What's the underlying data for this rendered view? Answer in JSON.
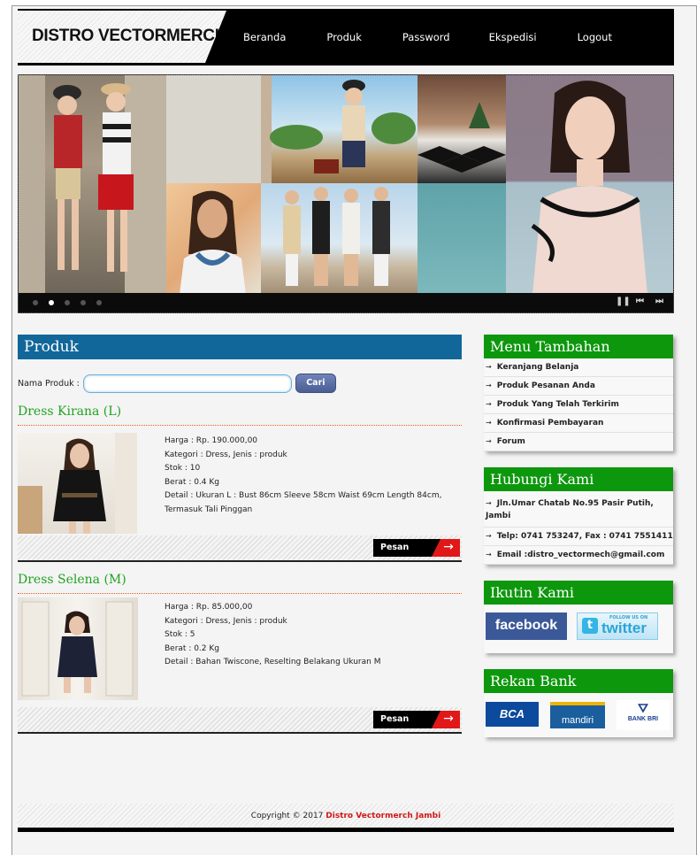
{
  "header": {
    "logo": "DISTRO VECTORMERCH"
  },
  "nav": {
    "items": [
      "Beranda",
      "Produk",
      "Password",
      "Ekspedisi",
      "Logout"
    ]
  },
  "slider": {
    "dots": 5,
    "active_dot": 2,
    "controls": [
      "❚❚",
      "⏮",
      "⏭"
    ]
  },
  "main": {
    "title": "Produk",
    "search": {
      "label": "Nama Produk :",
      "value": "",
      "button": "Cari"
    },
    "products": [
      {
        "name": "Dress Kirana (L)",
        "harga": "Harga : Rp. 190.000,00",
        "kategori": "Kategori : Dress, Jenis : produk",
        "stok": "Stok : 10",
        "berat": "Berat : 0.4 Kg",
        "detail": "Detail : Ukuran L : Bust 86cm Sleeve 58cm Waist 69cm Length 84cm, Termasuk Tali Pinggan",
        "button": "Pesan"
      },
      {
        "name": "Dress Selena (M)",
        "harga": "Harga : Rp. 85.000,00",
        "kategori": "Kategori : Dress, Jenis : produk",
        "stok": "Stok : 5",
        "berat": "Berat : 0.2 Kg",
        "detail": "Detail : Bahan Twiscone, Reselting Belakang Ukuran M",
        "button": "Pesan"
      }
    ]
  },
  "sidebar": {
    "menu": {
      "title": "Menu Tambahan",
      "items": [
        "Keranjang Belanja",
        "Produk Pesanan Anda",
        "Produk Yang Telah Terkirim",
        "Konfirmasi Pembayaran",
        "Forum"
      ]
    },
    "contact": {
      "title": "Hubungi Kami",
      "items": [
        "Jln.Umar Chatab No.95 Pasir Putih, Jambi",
        "Telp: 0741 753247, Fax : 0741 7551411",
        "Email :distro_vectormech@gmail.com"
      ]
    },
    "follow": {
      "title": "Ikutin Kami",
      "facebook": "facebook",
      "twitter_small": "FOLLOW US ON",
      "twitter": "twitter"
    },
    "bank": {
      "title": "Rekan Bank",
      "banks": [
        "BCA",
        "mandiri",
        "BANK BRI"
      ]
    }
  },
  "footer": {
    "text": "Copyright © 2017",
    "brand": "Distro Vectormerch Jambi"
  },
  "colors": {
    "accent_blue": "#11679a",
    "accent_green": "#0d970d",
    "product_green": "#21a221",
    "red": "#e01818"
  }
}
